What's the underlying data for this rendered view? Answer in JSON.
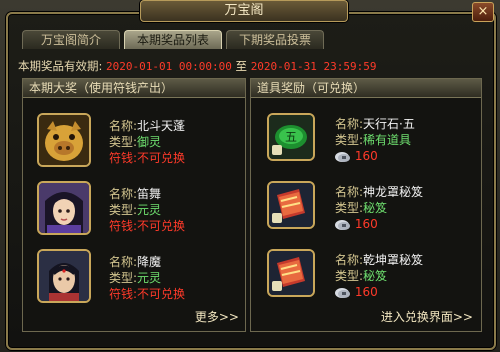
{
  "window": {
    "title": "万宝阁",
    "close": "×"
  },
  "tabs": [
    {
      "label": "万宝阁简介"
    },
    {
      "label": "本期奖品列表"
    },
    {
      "label": "下期奖品投票"
    }
  ],
  "validity": {
    "label": "本期奖品有效期:",
    "start": "2020-01-01 00:00:00",
    "sep": "至",
    "end": "2020-01-31 23:59:59"
  },
  "grand_prize": {
    "header": "本期大奖（使用符钱产出）",
    "items": [
      {
        "name_label": "名称:",
        "name": "北斗天蓬",
        "type_label": "类型:",
        "type": "御灵",
        "coin_label": "符钱:",
        "coin": "不可兑换"
      },
      {
        "name_label": "名称:",
        "name": "笛舞",
        "type_label": "类型:",
        "type": "元灵",
        "coin_label": "符钱:",
        "coin": "不可兑换"
      },
      {
        "name_label": "名称:",
        "name": "降魔",
        "type_label": "类型:",
        "type": "元灵",
        "coin_label": "符钱:",
        "coin": "不可兑换"
      }
    ],
    "more": "更多>>"
  },
  "item_rewards": {
    "header": "道具奖励（可兑换）",
    "items": [
      {
        "name_label": "名称:",
        "name": "天行石·五",
        "type_label": "类型:",
        "type": "稀有道具",
        "price": "160",
        "badge": "五"
      },
      {
        "name_label": "名称:",
        "name": "神龙罩秘笈",
        "type_label": "类型:",
        "type": "秘笈",
        "price": "160"
      },
      {
        "name_label": "名称:",
        "name": "乾坤罩秘笈",
        "type_label": "类型:",
        "type": "秘笈",
        "price": "160"
      }
    ],
    "exchange": "进入兑换界面>>"
  },
  "colors": {
    "label": "#d4c690",
    "value": "#f2f2f2",
    "green": "#6fe06f",
    "red": "#ff3a2a",
    "gold_border": "#c9a75a"
  }
}
